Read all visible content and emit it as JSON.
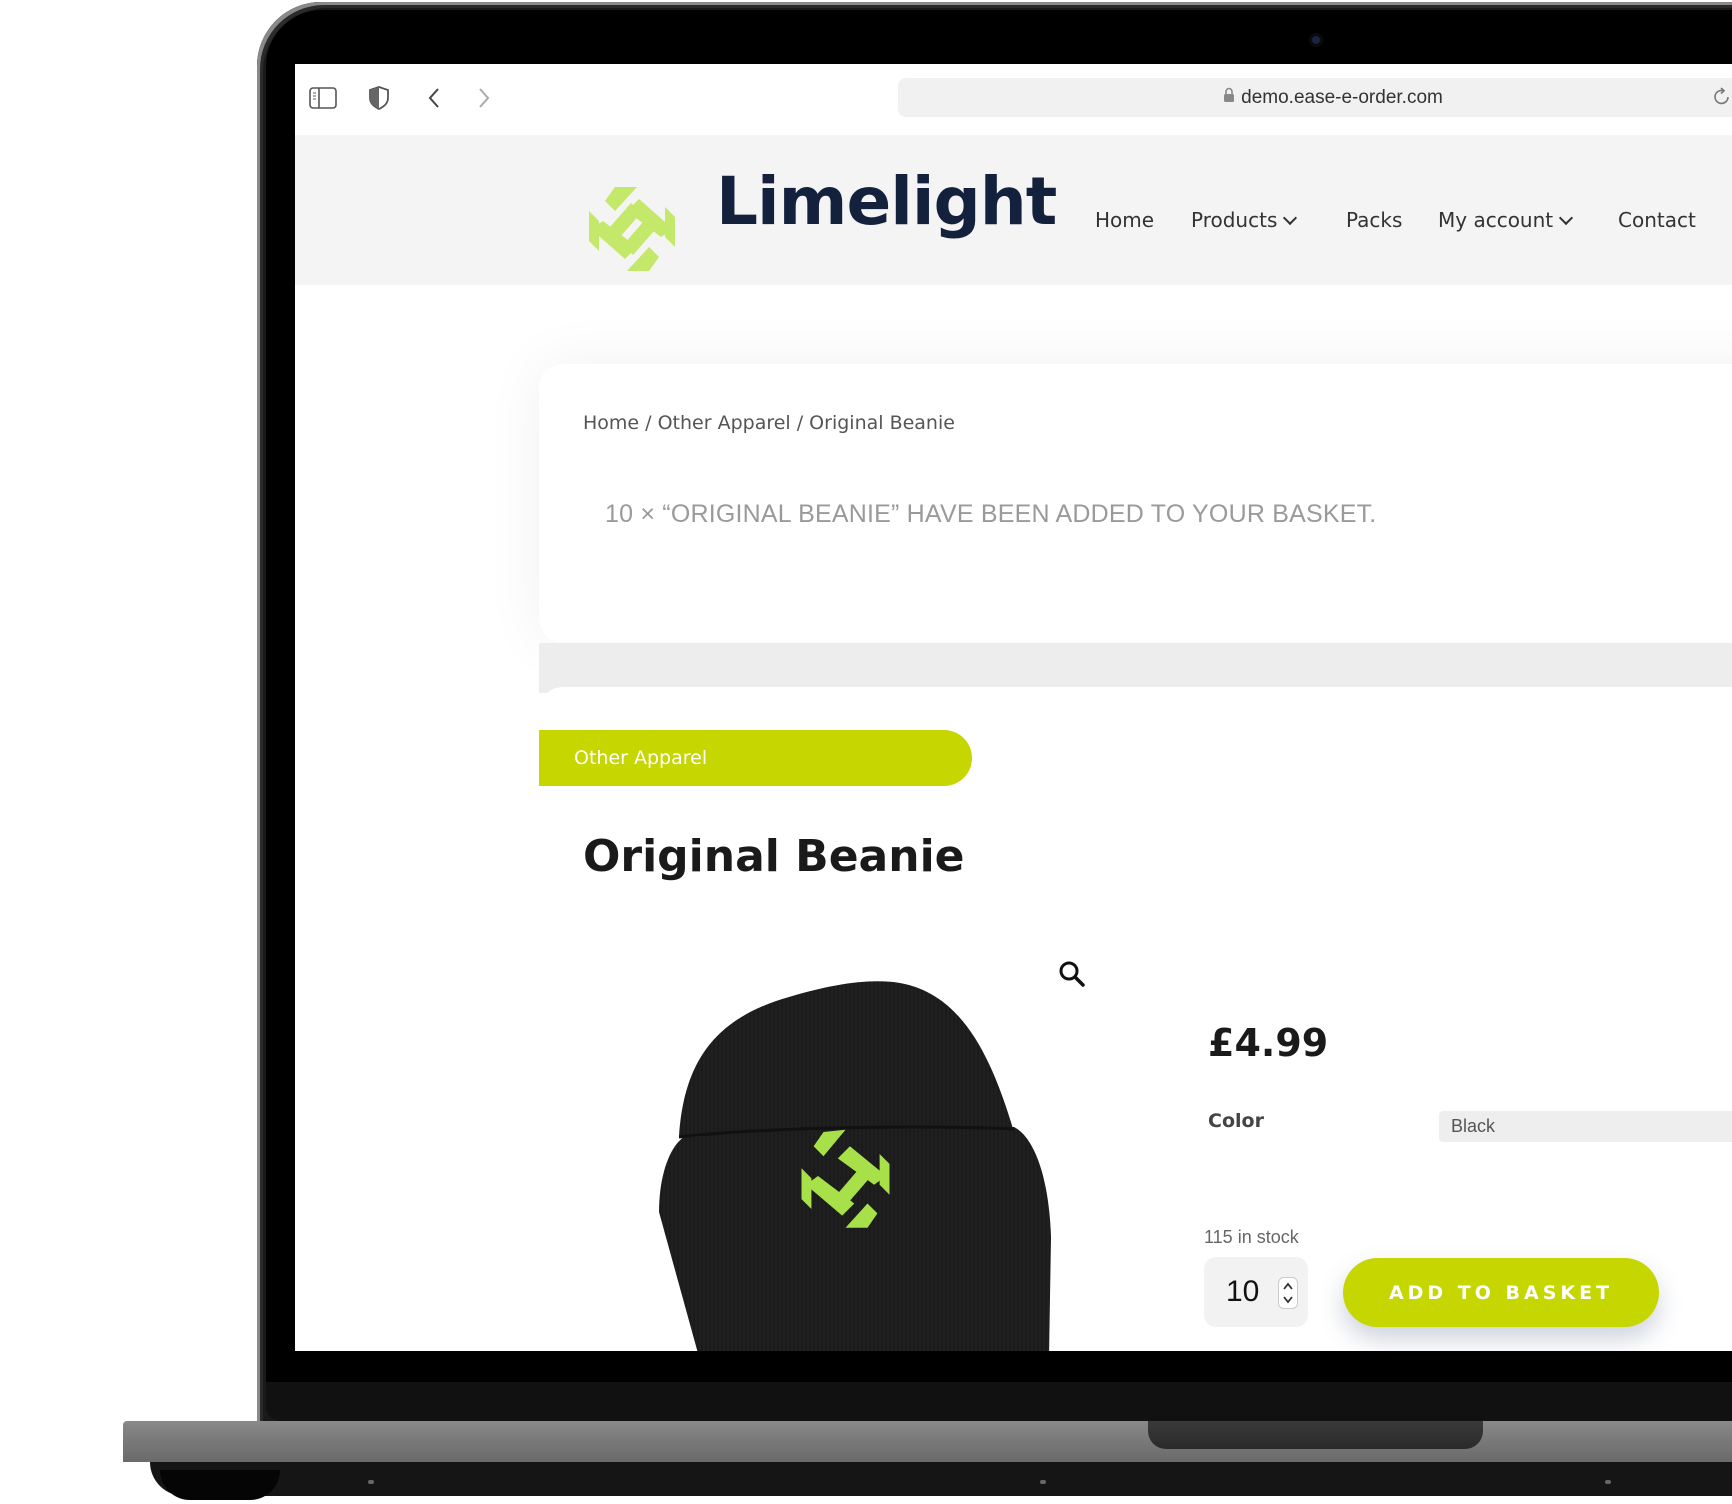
{
  "browser": {
    "url": "demo.ease-e-order.com",
    "icons": {
      "sidebar": "sidebar-icon",
      "privacy": "shield-icon",
      "back": "chevron-left-icon",
      "forward": "chevron-right-icon",
      "lock": "lock-icon",
      "reload": "reload-icon"
    }
  },
  "site": {
    "brand": "Limelight",
    "nav": [
      {
        "label": "Home",
        "has_dropdown": false
      },
      {
        "label": "Products",
        "has_dropdown": true
      },
      {
        "label": "Packs",
        "has_dropdown": false
      },
      {
        "label": "My account",
        "has_dropdown": true
      },
      {
        "label": "Contact",
        "has_dropdown": false
      }
    ]
  },
  "breadcrumb": "Home / Other Apparel / Original Beanie",
  "notice": "10 × “ORIGINAL BEANIE” HAVE BEEN ADDED TO YOUR BASKET.",
  "product": {
    "category": "Other Apparel",
    "title": "Original Beanie",
    "price": "£4.99",
    "color_label": "Color",
    "color_value": "Black",
    "stock": "115 in stock",
    "quantity": "10",
    "add_to_basket": "ADD TO BASKET"
  },
  "colors": {
    "accent": "#c5d600",
    "brand_text": "#14213d",
    "logo_green": "#c3e86a"
  }
}
